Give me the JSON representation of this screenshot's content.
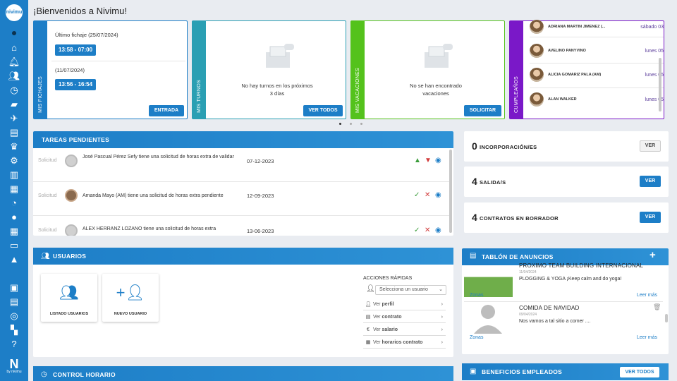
{
  "sidebar": {
    "logo": "nivimu",
    "brand": {
      "mark": "N",
      "by": "by nivimu"
    },
    "icons": [
      "home-icon",
      "bell-icon",
      "people-icon",
      "clock-icon",
      "briefcase-icon",
      "plane-icon",
      "id-card-icon",
      "trophy-icon",
      "gear-icon",
      "clipboard-icon",
      "chart-pie-icon",
      "chat-icon",
      "table-icon",
      "folder-icon",
      "graduation-cap-icon",
      "gift-icon",
      "message-icon",
      "target-icon",
      "grid-icon",
      "help-icon"
    ]
  },
  "header": {
    "title": "¡Bienvenidos a Nivimu!"
  },
  "fichajes": {
    "strip": "MIS FICHAJES",
    "last_label": "Último fichaje (25/07/2024)",
    "last_time": "13:58 - 07:00",
    "prev_label": "(11/07/2024)",
    "prev_time": "13:56 - 16:54",
    "button": "ENTRADA"
  },
  "turnos": {
    "strip": "MIS TURNOS",
    "empty_line1": "No hay turnos en los próximos",
    "empty_line2": "3 días",
    "button": "VER TODOS"
  },
  "vacaciones": {
    "strip": "MIS VACACIONES",
    "empty_line1": "No se han encontrado",
    "empty_line2": "vacaciones",
    "button": "SOLICITAR"
  },
  "cumpleanos": {
    "strip": "CUMPLEAÑOS",
    "people": [
      {
        "name": "ADRIANA MARTIN JIMENEZ (...",
        "date": "sábado 03"
      },
      {
        "name": "AVELINO PANYVINO",
        "date": "lunes 05"
      },
      {
        "name": "ALICIA GOMARIZ PALA (AM)",
        "date": "lunes 05"
      },
      {
        "name": "ALAN WALKER",
        "date": "lunes 05"
      }
    ]
  },
  "tareas": {
    "title": "TAREAS PENDIENTES",
    "rows": [
      {
        "type": "Solicitud",
        "text": "José Pascual Pérez Sefy tiene una solicitud de horas extra de validar",
        "date": "07-12-2023"
      },
      {
        "type": "Solicitud",
        "text": "Amanda Mayo (AM) tiene una solicitud de horas extra pendiente",
        "date": "12-09-2023"
      },
      {
        "type": "Solicitud",
        "text": "ALEX HERRANZ LOZANO tiene una solicitud de horas extra",
        "date": "13-06-2023"
      }
    ]
  },
  "stats": [
    {
      "num": "0",
      "label": "INCORPORACIÓN/ES",
      "button": "VER"
    },
    {
      "num": "4",
      "label": "SALIDA/S",
      "button": "VER"
    },
    {
      "num": "4",
      "label": "CONTRATOS EN BORRADOR",
      "button": "VER"
    }
  ],
  "usuarios": {
    "title": "USUARIOS",
    "tile_list": "LISTADO USUARIOS",
    "tile_new": "NUEVO USUARIO",
    "quick_title": "ACCIONES RÁPIDAS",
    "select_placeholder": "Selecciona un usuario",
    "actions": [
      {
        "prefix": "Ver",
        "bold": "perfil"
      },
      {
        "prefix": "Ver",
        "bold": "contrato"
      },
      {
        "prefix": "Ver",
        "bold": "salario"
      },
      {
        "prefix": "Ver",
        "bold": "horarios contrato"
      }
    ]
  },
  "tablon": {
    "title": "TABLÓN DE ANUNCIOS",
    "items": [
      {
        "title": "PROXIMO TEAM BUILDING INTERNACIONAL",
        "date": "11/04/2024",
        "body": "PLOGGING & YOGA ¡Keep calm and do yoga!",
        "tag": "Zonas",
        "more": "Leer más"
      },
      {
        "title": "COMIDA DE NAVIDAD",
        "date": "09/04/2024",
        "body": "Nos vamos a tal sitio a comer ....",
        "tag": "Zonas",
        "more": "Leer más"
      }
    ]
  },
  "control": {
    "title": "CONTROL HORARIO"
  },
  "beneficios": {
    "title": "BENEFICIOS EMPLEADOS",
    "button": "VER TODOS"
  },
  "colors": {
    "primary": "#1d7ec7",
    "turnos": "#2a9fb3",
    "vacaciones": "#54c21c",
    "cumple": "#7a18c8"
  }
}
